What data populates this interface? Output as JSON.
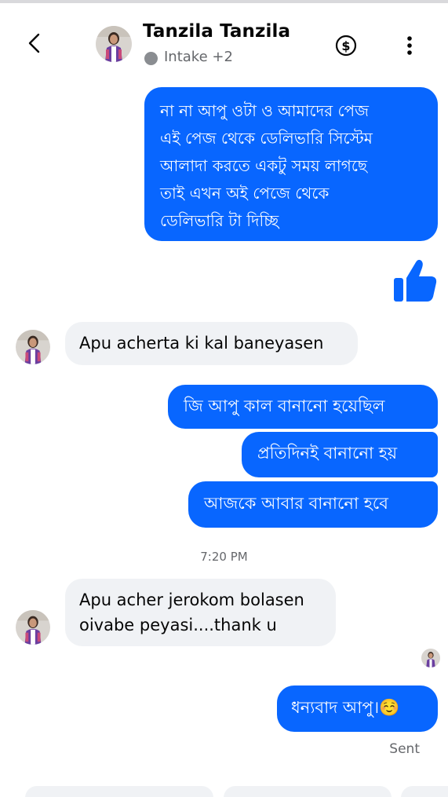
{
  "header": {
    "contact_name": "Tanzila Tanzila",
    "status_text": "Intake +2"
  },
  "messages": [
    {
      "direction": "outgoing",
      "text_lines": [
        "না না আপু ওটা ও আমাদের পেজ",
        "এই পেজ থেকে ডেলিভারি সিস্টেম",
        "আলাদা করতে একটু সময় লাগছে",
        "তাই এখন অই পেজে থেকে",
        "ডেলিভারি টা দিচ্ছি"
      ]
    },
    {
      "direction": "outgoing",
      "type": "like"
    },
    {
      "direction": "incoming",
      "text": "Apu  acherta ki kal baneyasen"
    },
    {
      "direction": "outgoing",
      "text": "জি আপু কাল বানানো হয়েছিল"
    },
    {
      "direction": "outgoing",
      "text": "প্রতিদিনই বানানো হয়"
    },
    {
      "direction": "outgoing",
      "text": "আজকে আবার বানানো হবে"
    },
    {
      "direction": "incoming",
      "text_lines": [
        "Apu acher jerokom bolasen",
        "oivabe peyasi....thank u"
      ]
    },
    {
      "direction": "outgoing",
      "text": "ধন্যবাদ আপু।☺️"
    }
  ],
  "timestamp": "7:20 PM",
  "delivery_status": "Sent",
  "colors": {
    "outgoing_bubble": "#0866ff",
    "incoming_bubble": "#f0f2f5",
    "secondary_text": "#65676b"
  }
}
